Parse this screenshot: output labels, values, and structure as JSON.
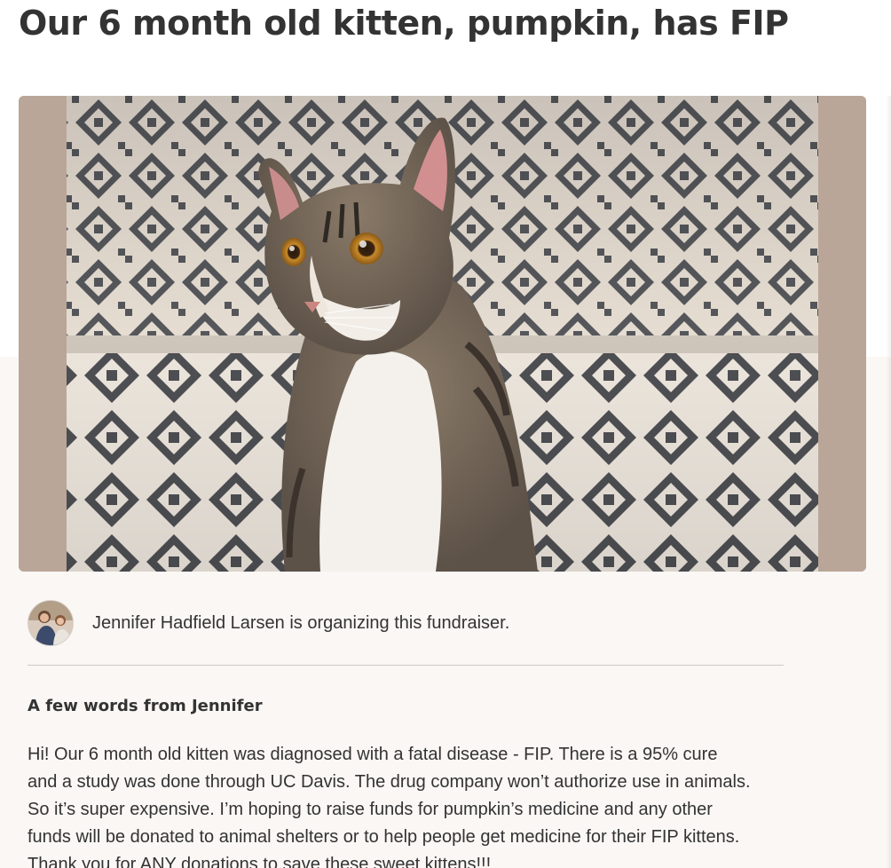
{
  "campaign": {
    "title": "Our 6 month old kitten, pumpkin, has FIP"
  },
  "organizer": {
    "text": "Jennifer Hadfield Larsen is organizing this fundraiser."
  },
  "story": {
    "heading": "A few words from Jennifer",
    "lines": [
      "Hi! Our 6 month old kitten was diagnosed with a fatal disease - FIP. There is a 95% cure",
      "and a study was done through UC Davis. The drug company won’t authorize use in animals.",
      "So it’s super expensive. I’m hoping to raise funds for pumpkin’s medicine and any other",
      "funds will be donated to animal shelters or to help people get medicine for their FIP kittens.",
      "Thank you for ANY donations to save these sweet kittens!!!"
    ]
  },
  "colors": {
    "text": "#333333",
    "page_background": "#faf7f4",
    "divider": "#cfcac5",
    "image_sidebar": "#b9a698"
  }
}
